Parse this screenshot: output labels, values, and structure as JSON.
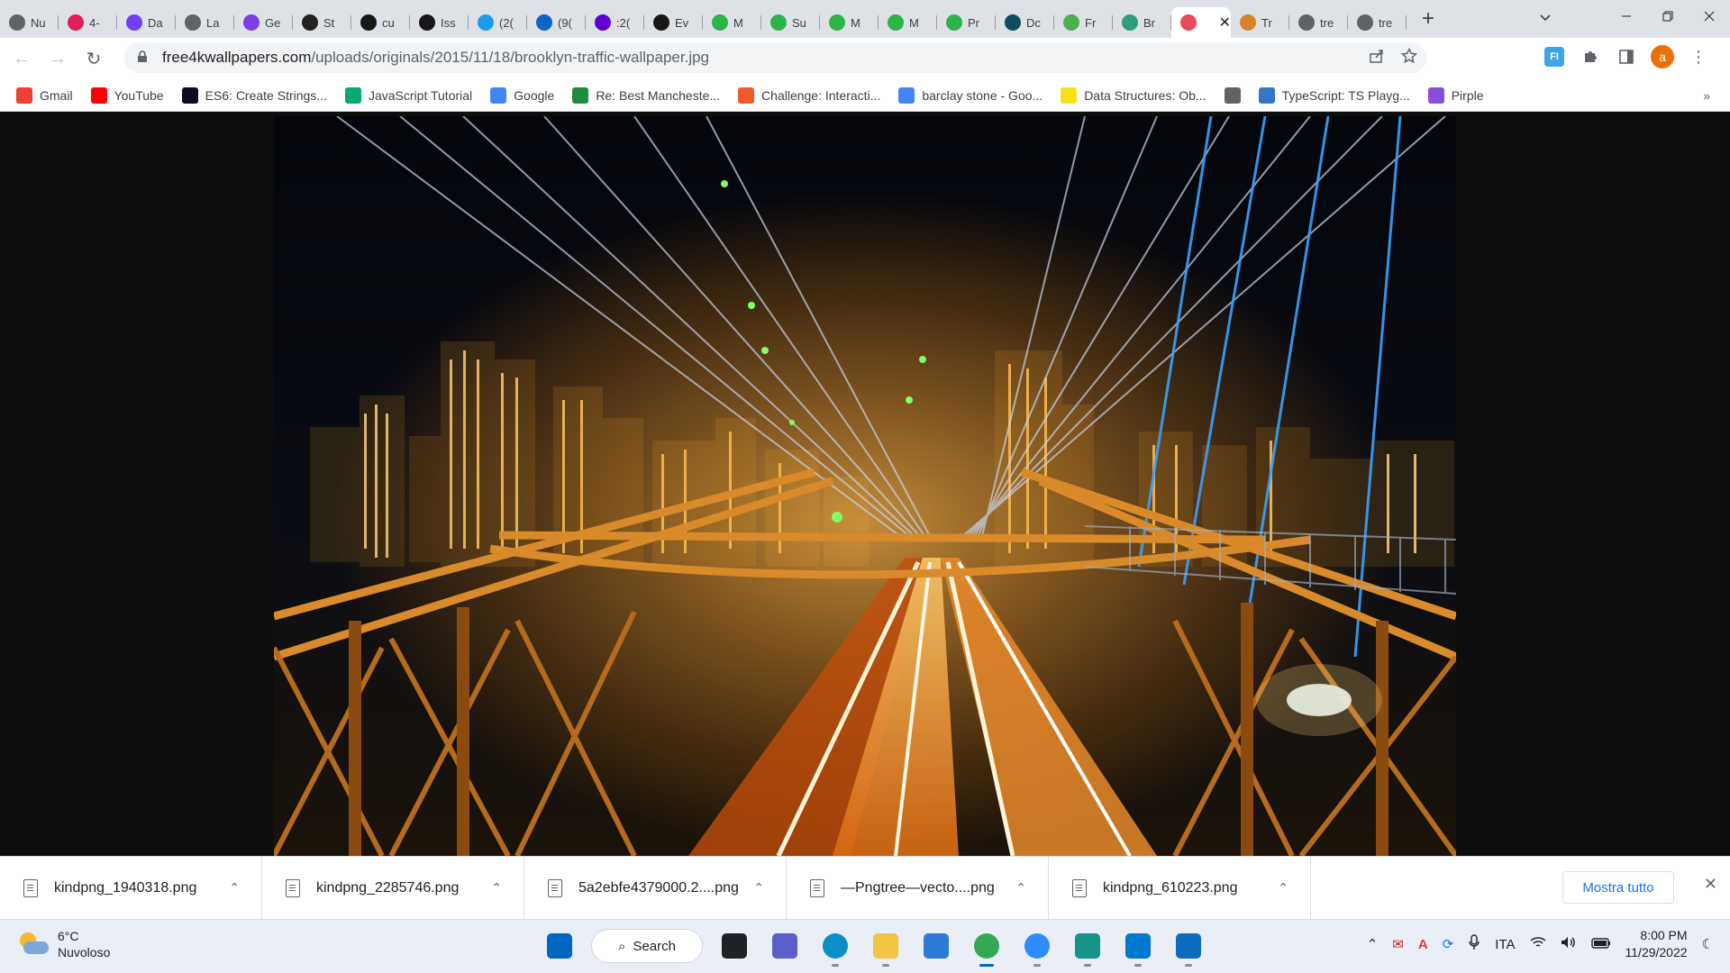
{
  "tabs": [
    {
      "title": "Nu",
      "icon": "globe-icon",
      "color": "#5f6368"
    },
    {
      "title": "4-",
      "icon": "slack-icon",
      "color": "#e01e5a"
    },
    {
      "title": "Da",
      "icon": "doc-icon",
      "color": "#6e3ff3"
    },
    {
      "title": "La",
      "icon": "globe-icon",
      "color": "#5f6368"
    },
    {
      "title": "Ge",
      "icon": "logo-icon",
      "color": "#7b3fe4"
    },
    {
      "title": "St",
      "icon": "react-icon",
      "color": "#222222"
    },
    {
      "title": "cu",
      "icon": "github-icon",
      "color": "#181717"
    },
    {
      "title": "Iss",
      "icon": "github-icon",
      "color": "#181717"
    },
    {
      "title": "(2(",
      "icon": "twitter-icon",
      "color": "#1d9bf0"
    },
    {
      "title": "(9(",
      "icon": "linkedin-icon",
      "color": "#0a66c2"
    },
    {
      "title": ":2(",
      "icon": "yahoo-icon",
      "color": "#6001d2"
    },
    {
      "title": "Ev",
      "icon": "github-icon",
      "color": "#181717"
    },
    {
      "title": "M",
      "icon": "cycle-icon",
      "color": "#2db34a"
    },
    {
      "title": "Su",
      "icon": "cycle-icon",
      "color": "#2db34a"
    },
    {
      "title": "M",
      "icon": "cycle-icon",
      "color": "#2db34a"
    },
    {
      "title": "M",
      "icon": "cycle-icon",
      "color": "#2db34a"
    },
    {
      "title": "Pr",
      "icon": "cycle-icon",
      "color": "#2db34a"
    },
    {
      "title": "Dc",
      "icon": "kp-icon",
      "color": "#0f4c5c"
    },
    {
      "title": "Fr",
      "icon": "leaf-icon",
      "color": "#4caf50"
    },
    {
      "title": "Br",
      "icon": "image-icon",
      "color": "#2e9f7b"
    },
    {
      "title": "",
      "icon": "image-icon",
      "color": "#e94b5b",
      "active": true
    },
    {
      "title": "Tr",
      "icon": "rooster-icon",
      "color": "#d9822b"
    },
    {
      "title": "tre",
      "icon": "globe-icon",
      "color": "#5f6368"
    },
    {
      "title": "tre",
      "icon": "globe-icon",
      "color": "#5f6368"
    }
  ],
  "url": {
    "domain": "free4kwallpapers.com",
    "path": "/uploads/originals/2015/11/18/brooklyn-traffic-wallpaper.jpg"
  },
  "profile": {
    "initial": "a",
    "color": "#e8710a"
  },
  "extension_label": "FI",
  "bookmarks": [
    {
      "label": "Gmail",
      "icon": "gmail-icon",
      "color": "#ea4335"
    },
    {
      "label": "YouTube",
      "icon": "youtube-icon",
      "color": "#ff0000"
    },
    {
      "label": "ES6: Create Strings...",
      "icon": "fcc-icon",
      "color": "#0a0a23"
    },
    {
      "label": "JavaScript Tutorial",
      "icon": "w3-icon",
      "color": "#04aa6d"
    },
    {
      "label": "Google",
      "icon": "google-icon",
      "color": "#4285f4"
    },
    {
      "label": "Re: Best Mancheste...",
      "icon": "grid-icon",
      "color": "#1e8e3e"
    },
    {
      "label": "Challenge: Interacti...",
      "icon": "ring-icon",
      "color": "#f05a28"
    },
    {
      "label": "barclay stone - Goo...",
      "icon": "google-icon",
      "color": "#4285f4"
    },
    {
      "label": "Data Structures: Ob...",
      "icon": "ejs-icon",
      "color": "#f7df1e"
    },
    {
      "label": "",
      "icon": "globe-icon",
      "color": "#5f6368"
    },
    {
      "label": "TypeScript: TS Playg...",
      "icon": "ts-icon",
      "color": "#3178c6"
    },
    {
      "label": "Pirple",
      "icon": "pirple-icon",
      "color": "#8a4fd8"
    }
  ],
  "downloads": [
    {
      "name": "kindpng_1940318.png"
    },
    {
      "name": "kindpng_2285746.png"
    },
    {
      "name": "5a2ebfe4379000.2....png"
    },
    {
      "name": "—Pngtree—vecto....png"
    },
    {
      "name": "kindpng_610223.png"
    }
  ],
  "show_all_label": "Mostra tutto",
  "weather": {
    "temp": "6°C",
    "desc": "Nuvoloso"
  },
  "taskbar": {
    "search_label": "Search",
    "apps": [
      {
        "name": "start-icon",
        "color": "#0067c0"
      },
      {
        "name": "task-view-icon",
        "color": "#202124"
      },
      {
        "name": "chat-icon",
        "color": "#5b5fc7"
      },
      {
        "name": "edge-icon",
        "color": "#0c8ecb"
      },
      {
        "name": "file-explorer-icon",
        "color": "#f4c542"
      },
      {
        "name": "photos-icon",
        "color": "#2b7bd6"
      },
      {
        "name": "chrome-icon",
        "color": "#34a853"
      },
      {
        "name": "zoom-icon",
        "color": "#2d8cff"
      },
      {
        "name": "gitkraken-icon",
        "color": "#179287"
      },
      {
        "name": "vscode-icon",
        "color": "#007acc"
      },
      {
        "name": "remote-icon",
        "color": "#0f6cbd"
      }
    ]
  },
  "tray": {
    "language": "ITA",
    "time": "8:00 PM",
    "date": "11/29/2022"
  }
}
